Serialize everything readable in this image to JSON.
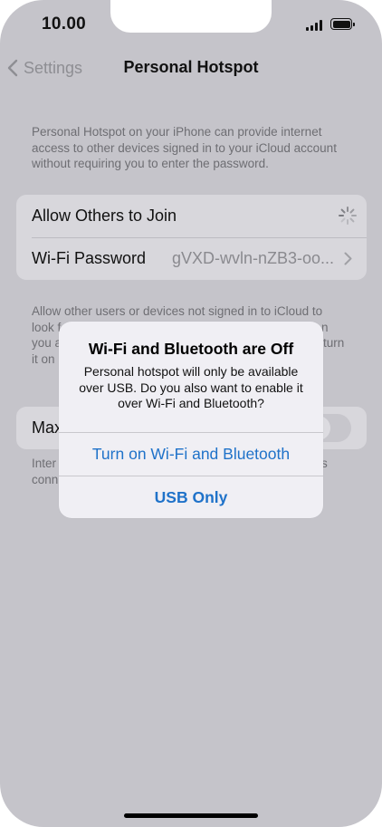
{
  "status_bar": {
    "time": "10.00",
    "signal_icon": "cellular-signal-icon",
    "battery_icon": "battery-icon"
  },
  "nav": {
    "back_label": "Settings",
    "back_icon": "chevron-left-icon",
    "title": "Personal Hotspot"
  },
  "main": {
    "intro": "Personal Hotspot on your iPhone can provide internet access to other devices signed in to your iCloud account without requiring you to enter the password.",
    "allow_others_label": "Allow Others to Join",
    "allow_others_icon": "loading-spinner-icon",
    "wifi_password_label": "Wi-Fi Password",
    "wifi_password_value": "gVXD-wvln-nZB3-oo...",
    "allow_note_line1": "Allow other users or devices not signed in to iCloud to",
    "allow_note_line2": "look f",
    "allow_note_line2_tail": "n",
    "allow_note_line3": "you a",
    "allow_note_line3_tail": "turn",
    "allow_note_line4": "it on",
    "maximize_label": "Max",
    "bottom_note_line1": "Inter",
    "bottom_note_line1_tail": "s",
    "bottom_note_line2": "conn"
  },
  "alert": {
    "title": "Wi-Fi and Bluetooth are Off",
    "message": "Personal hotspot will only be available over USB. Do you also want to enable it over Wi-Fi and Bluetooth?",
    "primary_action": "Turn on Wi-Fi and Bluetooth",
    "secondary_action": "USB Only"
  },
  "colors": {
    "accent": "#1f72c9",
    "dim_background": "#c5c4ca"
  }
}
